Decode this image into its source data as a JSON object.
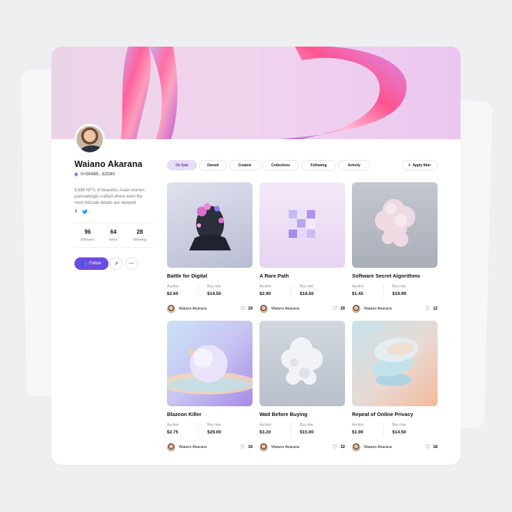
{
  "profile": {
    "name": "Waiano Akarana",
    "address": "0×59485...82590",
    "bio": "8,888 NFTs of beautiful, Asian women painstakingly-crafted where even the most intricate details are steeped",
    "socials": {
      "facebook": "f",
      "twitter": "t"
    },
    "stats": [
      {
        "value": "96",
        "label": "followers"
      },
      {
        "value": "64",
        "label": "items"
      },
      {
        "value": "28",
        "label": "following"
      }
    ],
    "follow_label": "Follow",
    "share_icon": "↗",
    "more_icon": "···"
  },
  "tabs": [
    {
      "label": "On Sale",
      "active": true
    },
    {
      "label": "Owned",
      "active": false
    },
    {
      "label": "Created",
      "active": false
    },
    {
      "label": "Collections",
      "active": false
    },
    {
      "label": "Following",
      "active": false
    },
    {
      "label": "Activity",
      "active": false
    }
  ],
  "filter": {
    "label": "Apply filter"
  },
  "price_labels": {
    "auction": "Auction",
    "buy": "Buy now"
  },
  "items": [
    {
      "title": "Battle for Digital",
      "auction": "$2.60",
      "buy": "$14.50",
      "owner": "Waiano Akarana",
      "likes": "19"
    },
    {
      "title": "A Rare Path",
      "auction": "$2.90",
      "buy": "$18.50",
      "owner": "Waiano Akarana",
      "likes": "20"
    },
    {
      "title": "Software Secret Algorithms",
      "auction": "$1.45",
      "buy": "$19.99",
      "owner": "Waiano Akarana",
      "likes": "12"
    },
    {
      "title": "Blazeon Killer",
      "auction": "$2.75",
      "buy": "$29.00",
      "owner": "Waiano Akarana",
      "likes": "16"
    },
    {
      "title": "Wait Before Buying",
      "auction": "$3.20",
      "buy": "$15.00",
      "owner": "Waiano Akarana",
      "likes": "32"
    },
    {
      "title": "Repeal of Online Privacy",
      "auction": "$1.90",
      "buy": "$14.50",
      "owner": "Waiano Akarana",
      "likes": "18"
    }
  ],
  "colors": {
    "accent": "#6d4be0",
    "active_tab_bg": "#e6dcf7",
    "facebook": "#3b5998",
    "twitter": "#1da1f2"
  }
}
